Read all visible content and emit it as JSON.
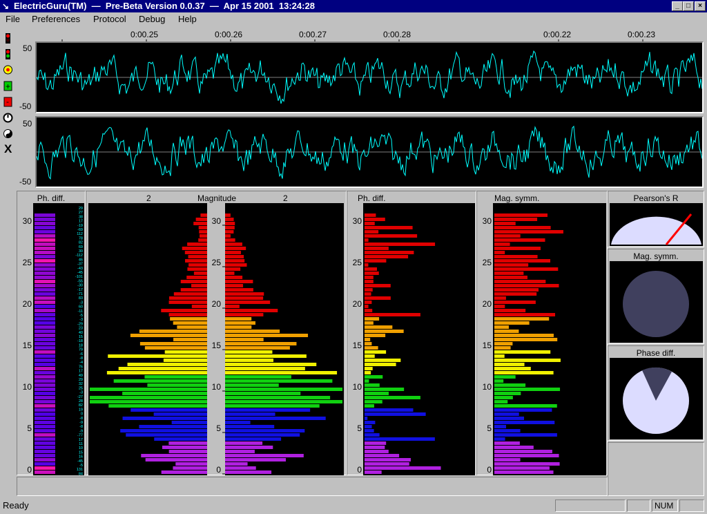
{
  "window": {
    "title": "ElectricGuru(TM)  —  Pre-Beta Version 0.0.37  —  Apr 15 2001  13:24:28",
    "min": "_",
    "max": "□",
    "close": "×"
  },
  "menu": {
    "file": "File",
    "preferences": "Preferences",
    "protocol": "Protocol",
    "debug": "Debug",
    "help": "Help"
  },
  "timeline": {
    "labels": [
      "0:00.25",
      "0:00.26",
      "0:00.27",
      "0:00.28",
      "0:00.22",
      "0:00.23"
    ]
  },
  "scopes": {
    "top": {
      "ymax": "50",
      "ymin": "-50"
    },
    "bottom": {
      "ymax": "50",
      "ymin": "-50"
    }
  },
  "panels": {
    "phdiff_left": {
      "title": "Ph. diff."
    },
    "magnitude": {
      "title": "Magnitude",
      "left_scale": "2",
      "right_scale": "2"
    },
    "phdiff_right": {
      "title": "Ph. diff."
    },
    "magsymm": {
      "title": "Mag. symm."
    },
    "pearson": {
      "title": "Pearson's R"
    },
    "gauge_magsymm": {
      "title": "Mag. symm."
    },
    "gauge_phasediff": {
      "title": "Phase diff."
    }
  },
  "y_ticks": [
    "30",
    "25",
    "20",
    "15",
    "10",
    "5",
    "0"
  ],
  "phase_values": [
    "29",
    "27",
    "38",
    "17",
    "-19",
    "-69",
    "112",
    "78",
    "82",
    "69",
    "30",
    "-112",
    "46",
    "-37",
    "-43",
    "-45",
    "-101",
    "-55",
    "-30",
    "-17",
    "-71",
    "83",
    "-3",
    "60",
    "-11",
    "-5",
    "-3",
    "-29",
    "23",
    "40",
    "15",
    "-18",
    "18",
    "79",
    "-6",
    "-8",
    "-4",
    "76",
    "17",
    "49",
    "29",
    "32",
    "25",
    "-3",
    "-27",
    "28",
    "82",
    "19",
    "0",
    "-8",
    "-9",
    "-8",
    "-9",
    "-77",
    "17",
    "11",
    "10",
    "15",
    "16",
    "-45",
    "-5",
    "131",
    "84"
  ],
  "magnitude_bands": [
    {
      "band": "0-4",
      "color": "#b020e0"
    },
    {
      "band": "4-8",
      "color": "#1010e0"
    },
    {
      "band": "8-12",
      "color": "#10d010"
    },
    {
      "band": "12-15",
      "color": "#f0f000"
    },
    {
      "band": "15-19",
      "color": "#f0a000"
    },
    {
      "band": "19-31",
      "color": "#e00000"
    }
  ],
  "status": {
    "text": "Ready",
    "num": "NUM"
  },
  "colors": {
    "trace": "#00ffff",
    "scope_bg": "#000000",
    "gauge_fill": "#40405e",
    "gauge_bg": "#dcdcff"
  }
}
